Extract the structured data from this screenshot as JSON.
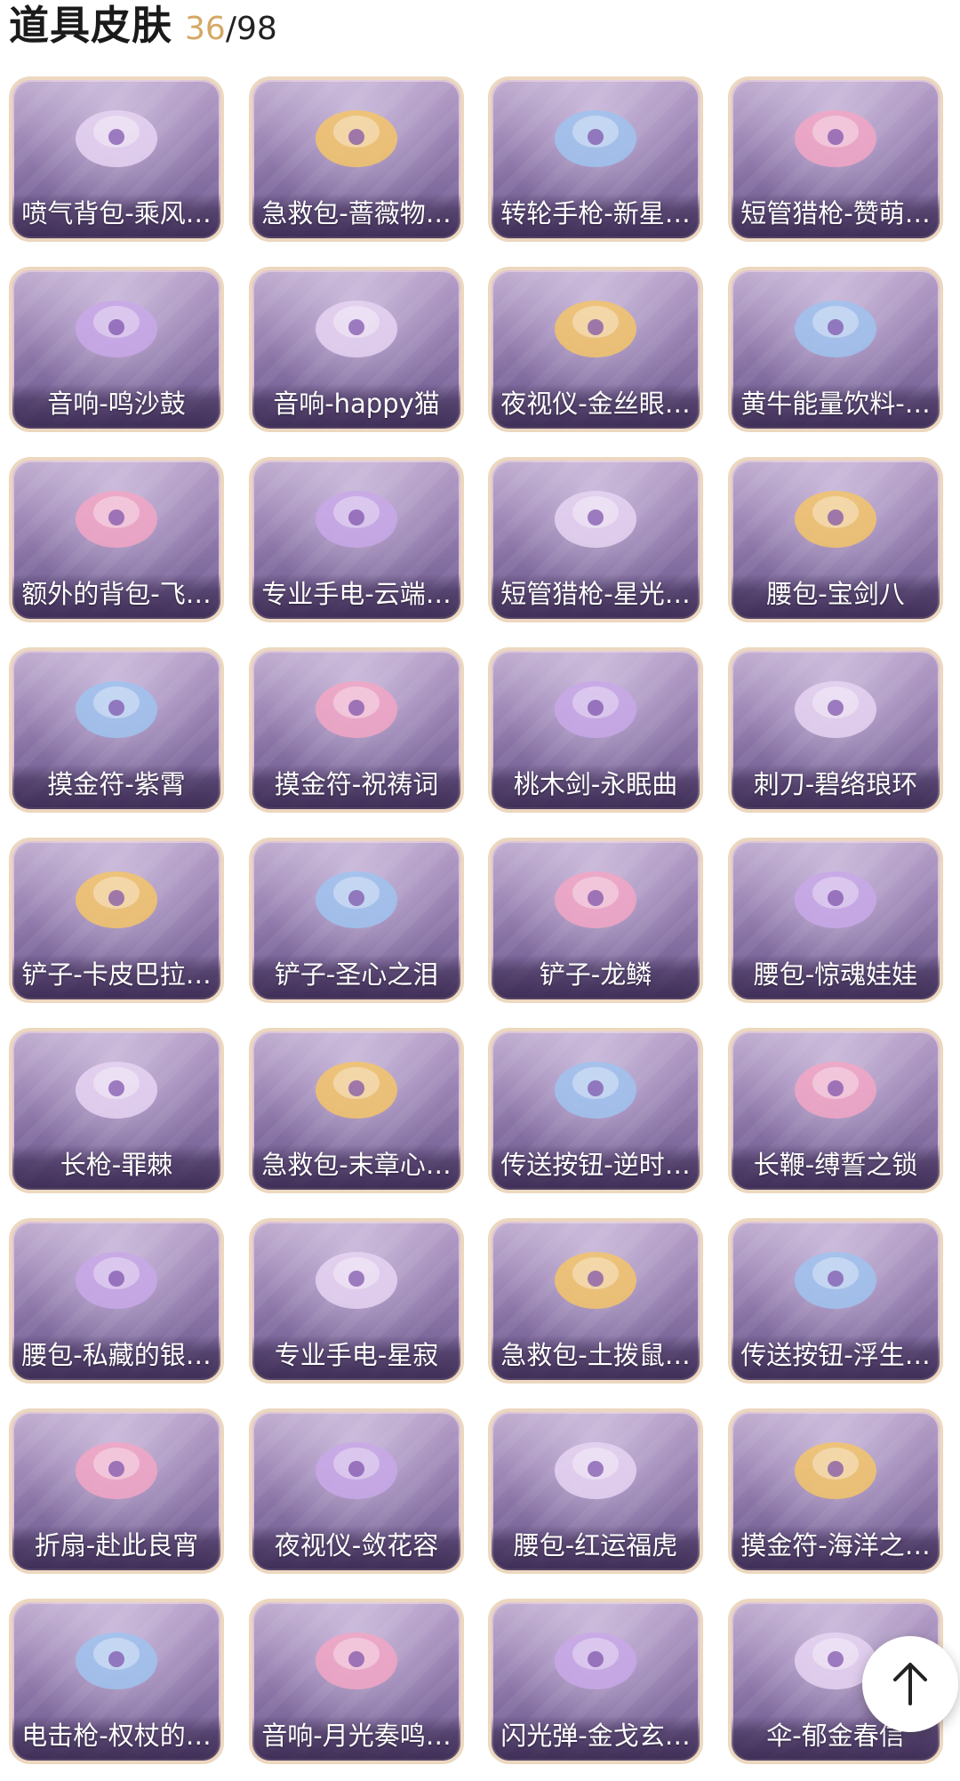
{
  "header": {
    "title": "道具皮肤",
    "owned": "36",
    "total": "/98"
  },
  "colors": {
    "owned_count": "#d4a865",
    "card_bg": "#9b84b4",
    "card_border": "#ecd7bf"
  },
  "items": [
    {
      "label": "喷气背包-乘风…",
      "icon": "jetpack-icon"
    },
    {
      "label": "急救包-蔷薇物…",
      "icon": "first-aid-kit-icon"
    },
    {
      "label": "转轮手枪-新星…",
      "icon": "revolver-icon"
    },
    {
      "label": "短管猎枪-赞萌…",
      "icon": "shotgun-icon"
    },
    {
      "label": "音响-鸣沙鼓",
      "icon": "drum-speaker-icon"
    },
    {
      "label": "音响-happy猫",
      "icon": "cat-speaker-icon"
    },
    {
      "label": "夜视仪-金丝眼…",
      "icon": "glasses-icon"
    },
    {
      "label": "黄牛能量饮料-…",
      "icon": "drink-cup-icon"
    },
    {
      "label": "额外的背包-飞…",
      "icon": "flower-backpack-icon"
    },
    {
      "label": "专业手电-云端…",
      "icon": "flashlight-icon"
    },
    {
      "label": "短管猎枪-星光…",
      "icon": "shotgun-icon"
    },
    {
      "label": "腰包-宝剑八",
      "icon": "heart-pouch-icon"
    },
    {
      "label": "摸金符-紫霄",
      "icon": "amulet-icon"
    },
    {
      "label": "摸金符-祝祷词",
      "icon": "cross-amulet-icon"
    },
    {
      "label": "桃木剑-永眠曲",
      "icon": "sword-icon"
    },
    {
      "label": "刺刀-碧络琅环",
      "icon": "dagger-icon"
    },
    {
      "label": "铲子-卡皮巴拉…",
      "icon": "capybara-shovel-icon"
    },
    {
      "label": "铲子-圣心之泪",
      "icon": "ruby-shovel-icon"
    },
    {
      "label": "铲子-龙鳞",
      "icon": "gold-shovel-icon"
    },
    {
      "label": "腰包-惊魂娃娃",
      "icon": "skull-doll-icon"
    },
    {
      "label": "长枪-罪棘",
      "icon": "spear-icon"
    },
    {
      "label": "急救包-末章心…",
      "icon": "scepter-icon"
    },
    {
      "label": "传送按钮-逆时…",
      "icon": "pocket-watch-icon"
    },
    {
      "label": "长鞭-缚誓之锁",
      "icon": "chain-whip-icon"
    },
    {
      "label": "腰包-私藏的银…",
      "icon": "cloud-pouch-icon"
    },
    {
      "label": "专业手电-星寂",
      "icon": "flashlight-icon"
    },
    {
      "label": "急救包-土拨鼠…",
      "icon": "hamster-icon"
    },
    {
      "label": "传送按钮-浮生…",
      "icon": "scroll-icon"
    },
    {
      "label": "折扇-赴此良宵",
      "icon": "fan-icon"
    },
    {
      "label": "夜视仪-敛花容",
      "icon": "flower-goggles-icon"
    },
    {
      "label": "腰包-红运福虎",
      "icon": "tiger-pouch-icon"
    },
    {
      "label": "摸金符-海洋之…",
      "icon": "ocean-amulet-icon"
    },
    {
      "label": "电击枪-权杖的…",
      "icon": "scepter-icon"
    },
    {
      "label": "音响-月光奏鸣…",
      "icon": "piano-icon"
    },
    {
      "label": "闪光弹-金戈玄…",
      "icon": "grenade-icon"
    },
    {
      "label": "伞-郁金春信",
      "icon": "umbrella-icon"
    }
  ],
  "scroll_top": {
    "icon": "arrow-up-icon"
  }
}
